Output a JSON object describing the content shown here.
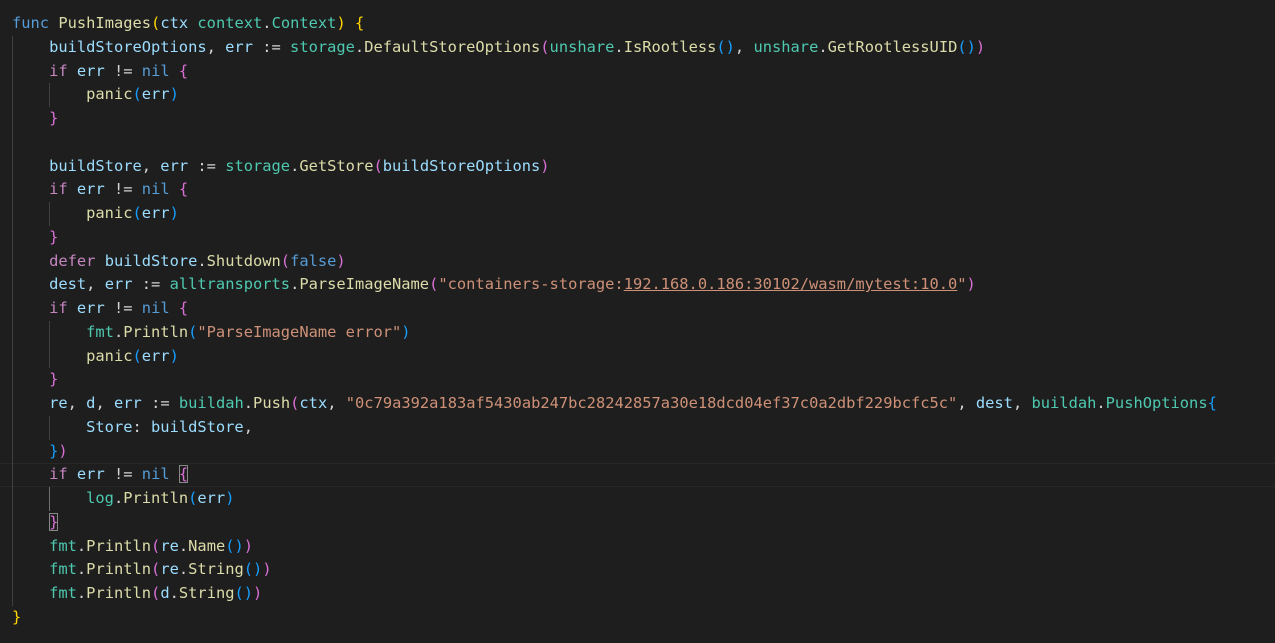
{
  "editor": {
    "language": "go",
    "colors": {
      "background": "#1e1e1e",
      "keyword": "#569cd6",
      "control": "#c586c0",
      "function": "#dcdcaa",
      "variable": "#9cdcfe",
      "string": "#ce9178",
      "bracket_1": "#ffd700",
      "bracket_2": "#da70d6",
      "bracket_3": "#179fff"
    },
    "current_line": 20,
    "lines": [
      [
        [
          "func",
          "kw"
        ],
        [
          " ",
          "pl"
        ],
        [
          "PushImages",
          "fn"
        ],
        [
          "(",
          "b1"
        ],
        [
          "ctx",
          "var"
        ],
        [
          " ",
          "pl"
        ],
        [
          "context",
          "typ"
        ],
        [
          ".",
          "pl"
        ],
        [
          "Context",
          "typ"
        ],
        [
          ")",
          "b1"
        ],
        [
          " ",
          "pl"
        ],
        [
          "{",
          "b1"
        ]
      ],
      [
        [
          "    ",
          "pl"
        ],
        [
          "buildStoreOptions",
          "var"
        ],
        [
          ", ",
          "pl"
        ],
        [
          "err",
          "var"
        ],
        [
          " := ",
          "pl"
        ],
        [
          "storage",
          "typ"
        ],
        [
          ".",
          "pl"
        ],
        [
          "DefaultStoreOptions",
          "fn"
        ],
        [
          "(",
          "b2"
        ],
        [
          "unshare",
          "typ"
        ],
        [
          ".",
          "pl"
        ],
        [
          "IsRootless",
          "fn"
        ],
        [
          "()",
          "b3"
        ],
        [
          ", ",
          "pl"
        ],
        [
          "unshare",
          "typ"
        ],
        [
          ".",
          "pl"
        ],
        [
          "GetRootlessUID",
          "fn"
        ],
        [
          "()",
          "b3"
        ],
        [
          ")",
          "b2"
        ]
      ],
      [
        [
          "    ",
          "pl"
        ],
        [
          "if",
          "ctl"
        ],
        [
          " ",
          "pl"
        ],
        [
          "err",
          "var"
        ],
        [
          " != ",
          "pl"
        ],
        [
          "nil",
          "kw"
        ],
        [
          " ",
          "pl"
        ],
        [
          "{",
          "b2"
        ]
      ],
      [
        [
          "        ",
          "pl"
        ],
        [
          "panic",
          "fn"
        ],
        [
          "(",
          "b3"
        ],
        [
          "err",
          "var"
        ],
        [
          ")",
          "b3"
        ]
      ],
      [
        [
          "    ",
          "pl"
        ],
        [
          "}",
          "b2"
        ]
      ],
      [],
      [
        [
          "    ",
          "pl"
        ],
        [
          "buildStore",
          "var"
        ],
        [
          ", ",
          "pl"
        ],
        [
          "err",
          "var"
        ],
        [
          " := ",
          "pl"
        ],
        [
          "storage",
          "typ"
        ],
        [
          ".",
          "pl"
        ],
        [
          "GetStore",
          "fn"
        ],
        [
          "(",
          "b2"
        ],
        [
          "buildStoreOptions",
          "var"
        ],
        [
          ")",
          "b2"
        ]
      ],
      [
        [
          "    ",
          "pl"
        ],
        [
          "if",
          "ctl"
        ],
        [
          " ",
          "pl"
        ],
        [
          "err",
          "var"
        ],
        [
          " != ",
          "pl"
        ],
        [
          "nil",
          "kw"
        ],
        [
          " ",
          "pl"
        ],
        [
          "{",
          "b2"
        ]
      ],
      [
        [
          "        ",
          "pl"
        ],
        [
          "panic",
          "fn"
        ],
        [
          "(",
          "b3"
        ],
        [
          "err",
          "var"
        ],
        [
          ")",
          "b3"
        ]
      ],
      [
        [
          "    ",
          "pl"
        ],
        [
          "}",
          "b2"
        ]
      ],
      [
        [
          "    ",
          "pl"
        ],
        [
          "defer",
          "ctl"
        ],
        [
          " ",
          "pl"
        ],
        [
          "buildStore",
          "var"
        ],
        [
          ".",
          "pl"
        ],
        [
          "Shutdown",
          "fn"
        ],
        [
          "(",
          "b2"
        ],
        [
          "false",
          "kw"
        ],
        [
          ")",
          "b2"
        ]
      ],
      [
        [
          "    ",
          "pl"
        ],
        [
          "dest",
          "var"
        ],
        [
          ", ",
          "pl"
        ],
        [
          "err",
          "var"
        ],
        [
          " := ",
          "pl"
        ],
        [
          "alltransports",
          "typ"
        ],
        [
          ".",
          "pl"
        ],
        [
          "ParseImageName",
          "fn"
        ],
        [
          "(",
          "b2"
        ],
        [
          "\"containers-storage:",
          "str"
        ],
        [
          "192.168.0.186:30102/wasm/mytest:10.0",
          "str ul"
        ],
        [
          "\"",
          "str"
        ],
        [
          ")",
          "b2"
        ]
      ],
      [
        [
          "    ",
          "pl"
        ],
        [
          "if",
          "ctl"
        ],
        [
          " ",
          "pl"
        ],
        [
          "err",
          "var"
        ],
        [
          " != ",
          "pl"
        ],
        [
          "nil",
          "kw"
        ],
        [
          " ",
          "pl"
        ],
        [
          "{",
          "b2"
        ]
      ],
      [
        [
          "        ",
          "pl"
        ],
        [
          "fmt",
          "typ"
        ],
        [
          ".",
          "pl"
        ],
        [
          "Println",
          "fn"
        ],
        [
          "(",
          "b3"
        ],
        [
          "\"ParseImageName error\"",
          "str"
        ],
        [
          ")",
          "b3"
        ]
      ],
      [
        [
          "        ",
          "pl"
        ],
        [
          "panic",
          "fn"
        ],
        [
          "(",
          "b3"
        ],
        [
          "err",
          "var"
        ],
        [
          ")",
          "b3"
        ]
      ],
      [
        [
          "    ",
          "pl"
        ],
        [
          "}",
          "b2"
        ]
      ],
      [
        [
          "    ",
          "pl"
        ],
        [
          "re",
          "var"
        ],
        [
          ", ",
          "pl"
        ],
        [
          "d",
          "var"
        ],
        [
          ", ",
          "pl"
        ],
        [
          "err",
          "var"
        ],
        [
          " := ",
          "pl"
        ],
        [
          "buildah",
          "typ"
        ],
        [
          ".",
          "pl"
        ],
        [
          "Push",
          "fn"
        ],
        [
          "(",
          "b2"
        ],
        [
          "ctx",
          "var"
        ],
        [
          ", ",
          "pl"
        ],
        [
          "\"0c79a392a183af5430ab247bc28242857a30e18dcd04ef37c0a2dbf229bcfc5c\"",
          "str"
        ],
        [
          ", ",
          "pl"
        ],
        [
          "dest",
          "var"
        ],
        [
          ", ",
          "pl"
        ],
        [
          "buildah",
          "typ"
        ],
        [
          ".",
          "pl"
        ],
        [
          "PushOptions",
          "typ"
        ],
        [
          "{",
          "b3"
        ]
      ],
      [
        [
          "        ",
          "pl"
        ],
        [
          "Store",
          "var"
        ],
        [
          ": ",
          "pl"
        ],
        [
          "buildStore",
          "var"
        ],
        [
          ",",
          "pl"
        ]
      ],
      [
        [
          "    ",
          "pl"
        ],
        [
          "}",
          "b3"
        ],
        [
          ")",
          "b2"
        ]
      ],
      [
        [
          "    ",
          "pl"
        ],
        [
          "if",
          "ctl"
        ],
        [
          " ",
          "pl"
        ],
        [
          "err",
          "var"
        ],
        [
          " != ",
          "pl"
        ],
        [
          "nil",
          "kw"
        ],
        [
          " ",
          "pl"
        ],
        [
          "{",
          "b2 bm"
        ]
      ],
      [
        [
          "        ",
          "pl"
        ],
        [
          "log",
          "typ"
        ],
        [
          ".",
          "pl"
        ],
        [
          "Println",
          "fn"
        ],
        [
          "(",
          "b3"
        ],
        [
          "err",
          "var"
        ],
        [
          ")",
          "b3"
        ]
      ],
      [
        [
          "    ",
          "pl"
        ],
        [
          "}",
          "b2 bm"
        ]
      ],
      [
        [
          "    ",
          "pl"
        ],
        [
          "fmt",
          "typ"
        ],
        [
          ".",
          "pl"
        ],
        [
          "Println",
          "fn"
        ],
        [
          "(",
          "b2"
        ],
        [
          "re",
          "var"
        ],
        [
          ".",
          "pl"
        ],
        [
          "Name",
          "fn"
        ],
        [
          "()",
          "b3"
        ],
        [
          ")",
          "b2"
        ]
      ],
      [
        [
          "    ",
          "pl"
        ],
        [
          "fmt",
          "typ"
        ],
        [
          ".",
          "pl"
        ],
        [
          "Println",
          "fn"
        ],
        [
          "(",
          "b2"
        ],
        [
          "re",
          "var"
        ],
        [
          ".",
          "pl"
        ],
        [
          "String",
          "fn"
        ],
        [
          "()",
          "b3"
        ],
        [
          ")",
          "b2"
        ]
      ],
      [
        [
          "    ",
          "pl"
        ],
        [
          "fmt",
          "typ"
        ],
        [
          ".",
          "pl"
        ],
        [
          "Println",
          "fn"
        ],
        [
          "(",
          "b2"
        ],
        [
          "d",
          "var"
        ],
        [
          ".",
          "pl"
        ],
        [
          "String",
          "fn"
        ],
        [
          "()",
          "b3"
        ],
        [
          ")",
          "b2"
        ]
      ],
      [
        [
          "}",
          "b1"
        ]
      ]
    ]
  }
}
